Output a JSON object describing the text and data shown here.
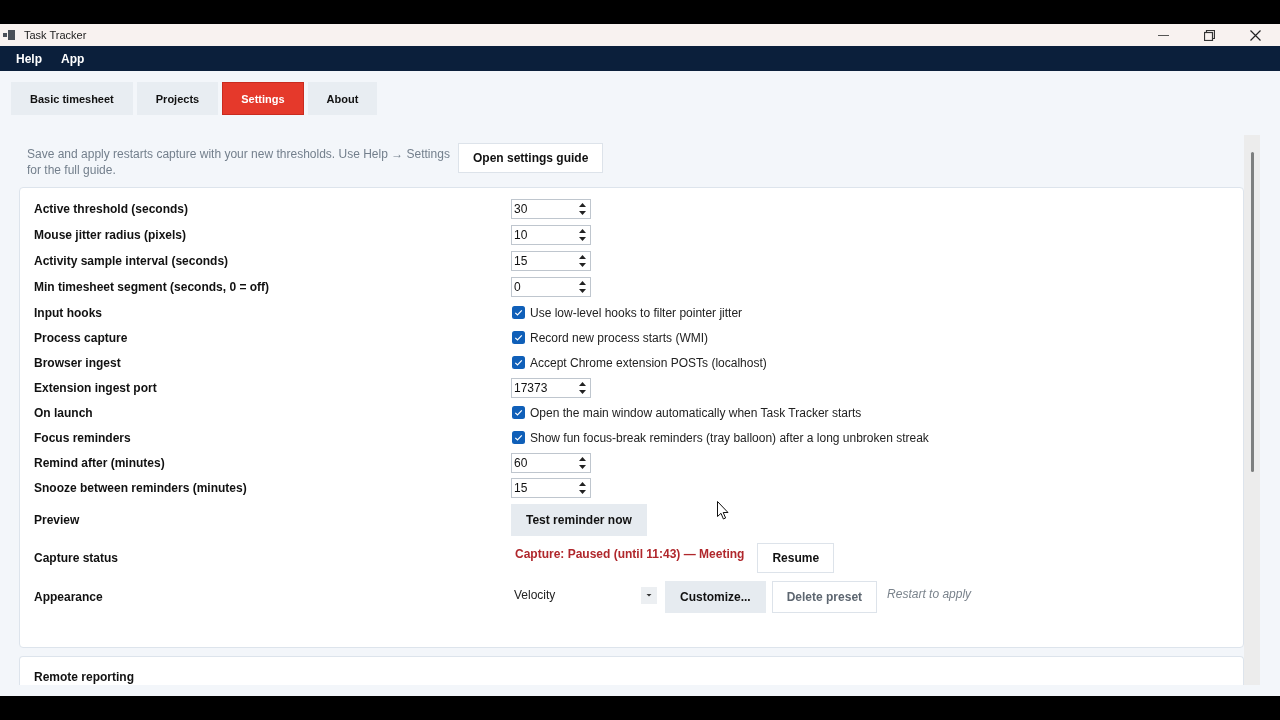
{
  "window": {
    "title": "Task Tracker"
  },
  "menu": [
    {
      "label": "Help"
    },
    {
      "label": "App"
    }
  ],
  "tabs": [
    {
      "label": "Basic timesheet",
      "selected": false
    },
    {
      "label": "Projects",
      "selected": false
    },
    {
      "label": "Settings",
      "selected": true
    },
    {
      "label": "About",
      "selected": false
    }
  ],
  "intro": {
    "text": "Save and apply restarts capture with your new thresholds. Use Help → Settings for the full guide.",
    "button": {
      "label": "Open settings guide",
      "kind": "outline"
    }
  },
  "settings": [
    {
      "kind": "spin",
      "label": "Active threshold (seconds)",
      "value": "30"
    },
    {
      "kind": "spin",
      "label": "Mouse jitter radius (pixels)",
      "value": "10"
    },
    {
      "kind": "spin",
      "label": "Activity sample interval (seconds)",
      "value": "15"
    },
    {
      "kind": "spin",
      "label": "Min timesheet segment (seconds, 0 = off)",
      "value": "0"
    },
    {
      "kind": "check",
      "label": "Input hooks",
      "text": "Use low-level hooks to filter pointer jitter",
      "checked": true
    },
    {
      "kind": "check",
      "label": "Process capture",
      "text": "Record new process starts (WMI)",
      "checked": true
    },
    {
      "kind": "check",
      "label": "Browser ingest",
      "text": "Accept Chrome extension POSTs (localhost)",
      "checked": true
    },
    {
      "kind": "spin",
      "label": "Extension ingest port",
      "value": "17373"
    },
    {
      "kind": "check",
      "label": "On launch",
      "text": "Open the main window automatically when Task Tracker starts",
      "checked": true
    },
    {
      "kind": "check",
      "label": "Focus reminders",
      "text": "Show fun focus-break reminders (tray balloon) after a long unbroken streak",
      "checked": true
    },
    {
      "kind": "spin",
      "label": "Remind after (minutes)",
      "value": "60"
    },
    {
      "kind": "spin",
      "label": "Snooze between reminders (minutes)",
      "value": "15"
    },
    {
      "kind": "button",
      "label": "Preview",
      "button": {
        "label": "Test reminder now",
        "kind": "filled"
      }
    },
    {
      "kind": "status",
      "label": "Capture status",
      "status": "Capture: Paused (until 11:43) — Meeting",
      "button": {
        "label": "Resume",
        "kind": "outline"
      }
    },
    {
      "kind": "theme",
      "label": "Appearance",
      "value": "Velocity",
      "buttons": [
        {
          "label": "Customize...",
          "kind": "filled",
          "disabled": false
        },
        {
          "label": "Delete preset",
          "kind": "outline",
          "disabled": true
        }
      ],
      "note": "Restart to apply"
    }
  ],
  "sections": [
    {
      "title": "Remote reporting"
    }
  ]
}
